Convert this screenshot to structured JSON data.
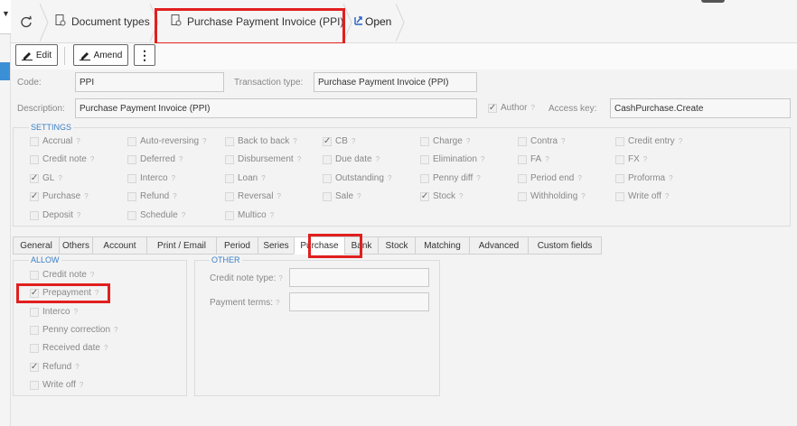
{
  "breadcrumb": {
    "items": [
      {
        "label": "Document types",
        "icon": "doc-settings-icon"
      },
      {
        "label": "Purchase Payment Invoice (PPI)",
        "icon": "doc-settings-icon"
      },
      {
        "label": "Open",
        "icon": "open-external-icon"
      }
    ]
  },
  "toolbar": {
    "edit_label": "Edit",
    "amend_label": "Amend",
    "more_glyph": "⋮"
  },
  "header": {
    "code_label": "Code:",
    "code_value": "PPI",
    "transaction_type_label": "Transaction type:",
    "transaction_type_value": "Purchase Payment Invoice (PPI)",
    "description_label": "Description:",
    "description_value": "Purchase Payment Invoice (PPI)",
    "author_label": "Author",
    "author_checked": true,
    "access_key_label": "Access key:",
    "access_key_value": "CashPurchase.Create"
  },
  "settings": {
    "legend": "SETTINGS",
    "rows": [
      [
        {
          "label": "Accrual",
          "checked": false
        },
        {
          "label": "Auto-reversing",
          "checked": false
        },
        {
          "label": "Back to back",
          "checked": false
        },
        {
          "label": "CB",
          "checked": true
        },
        {
          "label": "Charge",
          "checked": false
        },
        {
          "label": "Contra",
          "checked": false
        },
        {
          "label": "Credit entry",
          "checked": false
        }
      ],
      [
        {
          "label": "Credit note",
          "checked": false
        },
        {
          "label": "Deferred",
          "checked": false
        },
        {
          "label": "Disbursement",
          "checked": false
        },
        {
          "label": "Due date",
          "checked": false
        },
        {
          "label": "Elimination",
          "checked": false
        },
        {
          "label": "FA",
          "checked": false
        },
        {
          "label": "FX",
          "checked": false
        }
      ],
      [
        {
          "label": "GL",
          "checked": true
        },
        {
          "label": "Interco",
          "checked": false
        },
        {
          "label": "Loan",
          "checked": false
        },
        {
          "label": "Outstanding",
          "checked": false
        },
        {
          "label": "Penny diff",
          "checked": false
        },
        {
          "label": "Period end",
          "checked": false
        },
        {
          "label": "Proforma",
          "checked": false
        }
      ],
      [
        {
          "label": "Purchase",
          "checked": true
        },
        {
          "label": "Refund",
          "checked": false
        },
        {
          "label": "Reversal",
          "checked": false
        },
        {
          "label": "Sale",
          "checked": false
        },
        {
          "label": "Stock",
          "checked": true
        },
        {
          "label": "Withholding",
          "checked": false
        },
        {
          "label": "Write off",
          "checked": false
        }
      ],
      [
        {
          "label": "Deposit",
          "checked": false
        },
        {
          "label": "Schedule",
          "checked": false
        },
        {
          "label": "Multico",
          "checked": false
        }
      ]
    ]
  },
  "tabs": [
    "General",
    "Others",
    "Account",
    "Print / Email",
    "Period",
    "Series",
    "Purchase",
    "Bank",
    "Stock",
    "Matching",
    "Advanced",
    "Custom fields"
  ],
  "active_tab": "Purchase",
  "allow": {
    "legend": "ALLOW",
    "items": [
      {
        "label": "Credit note",
        "checked": false
      },
      {
        "label": "Prepayment",
        "checked": true
      },
      {
        "label": "Interco",
        "checked": false
      },
      {
        "label": "Penny correction",
        "checked": false
      },
      {
        "label": "Received date",
        "checked": false
      },
      {
        "label": "Refund",
        "checked": true
      },
      {
        "label": "Write off",
        "checked": false
      }
    ]
  },
  "other": {
    "legend": "OTHER",
    "credit_note_type_label": "Credit note type:",
    "credit_note_type_value": "",
    "payment_terms_label": "Payment terms:",
    "payment_terms_value": ""
  },
  "help_glyph": "?",
  "colors": {
    "highlight_red": "#e0201e",
    "legend_blue": "#3a7fc4",
    "left_marker_blue": "#3b8fd5"
  }
}
